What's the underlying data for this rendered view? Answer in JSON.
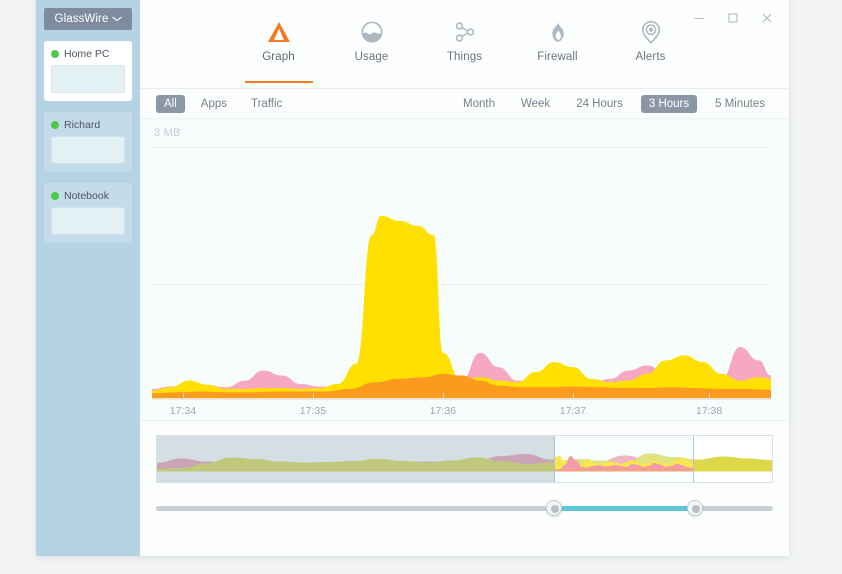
{
  "window": {
    "controls": [
      {
        "name": "minimize",
        "glyph": "minimize-icon"
      },
      {
        "name": "maximize",
        "glyph": "maximize-icon"
      },
      {
        "name": "close",
        "glyph": "close-icon"
      }
    ]
  },
  "sidebar": {
    "brand": "GlassWire",
    "brand_caret": "⌄",
    "devices": [
      {
        "name": "Home PC",
        "status": "online",
        "selected": true
      },
      {
        "name": "Richard",
        "status": "online",
        "selected": false
      },
      {
        "name": "Notebook",
        "status": "online",
        "selected": false
      }
    ]
  },
  "nav": {
    "tabs": [
      {
        "label": "Graph",
        "icon": "graph-mountain-icon",
        "active": true
      },
      {
        "label": "Usage",
        "icon": "usage-circle-icon",
        "active": false
      },
      {
        "label": "Things",
        "icon": "things-nodes-icon",
        "active": false
      },
      {
        "label": "Firewall",
        "icon": "firewall-flame-icon",
        "active": false
      },
      {
        "label": "Alerts",
        "icon": "alerts-pin-icon",
        "active": false
      }
    ]
  },
  "filters": {
    "views": [
      {
        "label": "All",
        "active": true
      },
      {
        "label": "Apps",
        "active": false
      },
      {
        "label": "Traffic",
        "active": false
      }
    ],
    "ranges": [
      {
        "label": "Month",
        "active": false
      },
      {
        "label": "Week",
        "active": false
      },
      {
        "label": "24 Hours",
        "active": false
      },
      {
        "label": "3 Hours",
        "active": true
      },
      {
        "label": "5 Minutes",
        "active": false
      }
    ]
  },
  "colors": {
    "accent": "#f47a20",
    "yellow": "#ffe000",
    "orange": "#fb9a1c",
    "pink": "#f6a8c0",
    "status_green": "#4ec94e",
    "slider_teal": "#5ec8d8",
    "sidebar_blue": "#b6d3e4",
    "chip_active_bg": "#8c97a5"
  },
  "chart_data": {
    "type": "area",
    "title": "",
    "xlabel": "",
    "ylabel": "3 MB",
    "ylim": [
      0,
      3
    ],
    "yunit": "MB",
    "y_axis_max_label": "3 MB",
    "grid": true,
    "gridlines": [
      3,
      1.5
    ],
    "x_tick_labels": [
      "17:34",
      "17:35",
      "17:36",
      "17:37",
      "17:38"
    ],
    "x_tick_positions": [
      0.05,
      0.26,
      0.47,
      0.68,
      0.9
    ],
    "stacked": false,
    "legend": "none",
    "series": [
      {
        "name": "pink-traffic",
        "color": "#f6a8c0",
        "x": [
          0.0,
          0.03,
          0.06,
          0.09,
          0.12,
          0.15,
          0.18,
          0.21,
          0.24,
          0.27,
          0.3,
          0.33,
          0.36,
          0.4,
          0.44,
          0.47,
          0.5,
          0.53,
          0.56,
          0.59,
          0.62,
          0.65,
          0.68,
          0.71,
          0.74,
          0.77,
          0.8,
          0.83,
          0.86,
          0.89,
          0.92,
          0.95,
          0.98,
          1.0
        ],
        "values": [
          0.12,
          0.15,
          0.2,
          0.16,
          0.14,
          0.22,
          0.34,
          0.28,
          0.18,
          0.15,
          0.14,
          0.16,
          0.2,
          0.24,
          0.3,
          0.26,
          0.22,
          0.55,
          0.38,
          0.22,
          0.2,
          0.18,
          0.17,
          0.19,
          0.24,
          0.34,
          0.4,
          0.32,
          0.22,
          0.2,
          0.24,
          0.62,
          0.46,
          0.28
        ]
      },
      {
        "name": "yellow-traffic",
        "color": "#ffe000",
        "x": [
          0.0,
          0.03,
          0.06,
          0.09,
          0.12,
          0.15,
          0.18,
          0.21,
          0.24,
          0.27,
          0.3,
          0.33,
          0.355,
          0.37,
          0.4,
          0.43,
          0.455,
          0.47,
          0.5,
          0.53,
          0.56,
          0.59,
          0.62,
          0.65,
          0.68,
          0.71,
          0.74,
          0.77,
          0.8,
          0.83,
          0.86,
          0.89,
          0.92,
          0.95,
          0.98,
          1.0
        ],
        "values": [
          0.1,
          0.14,
          0.22,
          0.17,
          0.12,
          0.12,
          0.13,
          0.13,
          0.12,
          0.13,
          0.18,
          0.42,
          1.95,
          2.18,
          2.12,
          2.06,
          1.95,
          0.55,
          0.22,
          0.26,
          0.22,
          0.2,
          0.32,
          0.44,
          0.38,
          0.24,
          0.2,
          0.22,
          0.3,
          0.46,
          0.52,
          0.44,
          0.3,
          0.22,
          0.26,
          0.24
        ]
      },
      {
        "name": "orange-traffic",
        "color": "#fb9a1c",
        "x": [
          0.0,
          0.04,
          0.08,
          0.12,
          0.16,
          0.2,
          0.24,
          0.28,
          0.32,
          0.36,
          0.4,
          0.44,
          0.47,
          0.5,
          0.53,
          0.56,
          0.6,
          0.64,
          0.68,
          0.72,
          0.76,
          0.8,
          0.84,
          0.88,
          0.92,
          0.96,
          1.0
        ],
        "values": [
          0.07,
          0.08,
          0.09,
          0.08,
          0.08,
          0.09,
          0.09,
          0.09,
          0.12,
          0.2,
          0.24,
          0.26,
          0.3,
          0.28,
          0.22,
          0.16,
          0.14,
          0.14,
          0.15,
          0.14,
          0.13,
          0.13,
          0.14,
          0.13,
          0.12,
          0.12,
          0.11
        ]
      }
    ]
  },
  "scrubber": {
    "selection_start_pct": 64.5,
    "selection_width_pct": 22.8,
    "overview_series": [
      {
        "name": "pink-overview",
        "color": "#f19aaf",
        "x": [
          0.0,
          0.04,
          0.08,
          0.12,
          0.16,
          0.2,
          0.24,
          0.28,
          0.32,
          0.36,
          0.4,
          0.44,
          0.48,
          0.52,
          0.56,
          0.6,
          0.64,
          0.68,
          0.72,
          0.76,
          0.8,
          0.84,
          0.88,
          0.92,
          0.96,
          1.0
        ],
        "values": [
          0.35,
          0.52,
          0.4,
          0.34,
          0.36,
          0.34,
          0.33,
          0.34,
          0.36,
          0.34,
          0.36,
          0.4,
          0.38,
          0.42,
          0.62,
          0.7,
          0.48,
          0.36,
          0.4,
          0.64,
          0.48,
          0.52,
          0.44,
          0.56,
          0.5,
          0.44
        ]
      },
      {
        "name": "yellow-overview",
        "color": "#dcd84a",
        "x": [
          0.0,
          0.04,
          0.08,
          0.12,
          0.16,
          0.2,
          0.24,
          0.28,
          0.32,
          0.36,
          0.4,
          0.44,
          0.48,
          0.52,
          0.56,
          0.6,
          0.64,
          0.68,
          0.72,
          0.76,
          0.8,
          0.84,
          0.88,
          0.92,
          0.96,
          1.0
        ],
        "values": [
          0.1,
          0.14,
          0.32,
          0.56,
          0.5,
          0.4,
          0.36,
          0.38,
          0.42,
          0.5,
          0.42,
          0.36,
          0.44,
          0.56,
          0.42,
          0.3,
          0.36,
          0.5,
          0.44,
          0.32,
          0.72,
          0.58,
          0.48,
          0.6,
          0.52,
          0.46
        ]
      }
    ],
    "selection_series": [
      {
        "name": "yellow-selection",
        "color": "#ffe000",
        "x": [
          0.0,
          0.04,
          0.08,
          0.12,
          0.16,
          0.2,
          0.24,
          0.28,
          0.32,
          0.36,
          0.4,
          0.44,
          0.48,
          0.52,
          0.56,
          0.6,
          0.64,
          0.68,
          0.72,
          0.76,
          0.8,
          0.84,
          0.88,
          0.92,
          0.96,
          1.0
        ],
        "values": [
          0.55,
          0.62,
          0.4,
          0.3,
          0.34,
          0.3,
          0.52,
          0.34,
          0.3,
          0.34,
          0.4,
          0.36,
          0.3,
          0.38,
          0.46,
          0.36,
          0.3,
          0.34,
          0.42,
          0.36,
          0.3,
          0.34,
          0.46,
          0.56,
          0.42,
          0.36
        ]
      },
      {
        "name": "pink-selection",
        "color": "#f4748c",
        "x": [
          0.0,
          0.04,
          0.08,
          0.12,
          0.16,
          0.2,
          0.24,
          0.28,
          0.32,
          0.36,
          0.4,
          0.44,
          0.48,
          0.52,
          0.56,
          0.6,
          0.64,
          0.68,
          0.72,
          0.76,
          0.8,
          0.84,
          0.88,
          0.92,
          0.96,
          1.0
        ],
        "values": [
          0.05,
          0.08,
          0.26,
          0.62,
          0.44,
          0.18,
          0.16,
          0.22,
          0.26,
          0.2,
          0.22,
          0.26,
          0.22,
          0.18,
          0.3,
          0.26,
          0.18,
          0.22,
          0.34,
          0.28,
          0.18,
          0.22,
          0.32,
          0.24,
          0.16,
          0.14
        ]
      },
      {
        "name": "orange-selection",
        "color": "#fb7b4a",
        "x": [
          0.0,
          0.1,
          0.2,
          0.3,
          0.4,
          0.5,
          0.6,
          0.7,
          0.8,
          0.9,
          1.0
        ],
        "values": [
          0.08,
          0.1,
          0.12,
          0.12,
          0.12,
          0.12,
          0.12,
          0.12,
          0.12,
          0.12,
          0.1
        ]
      }
    ]
  }
}
